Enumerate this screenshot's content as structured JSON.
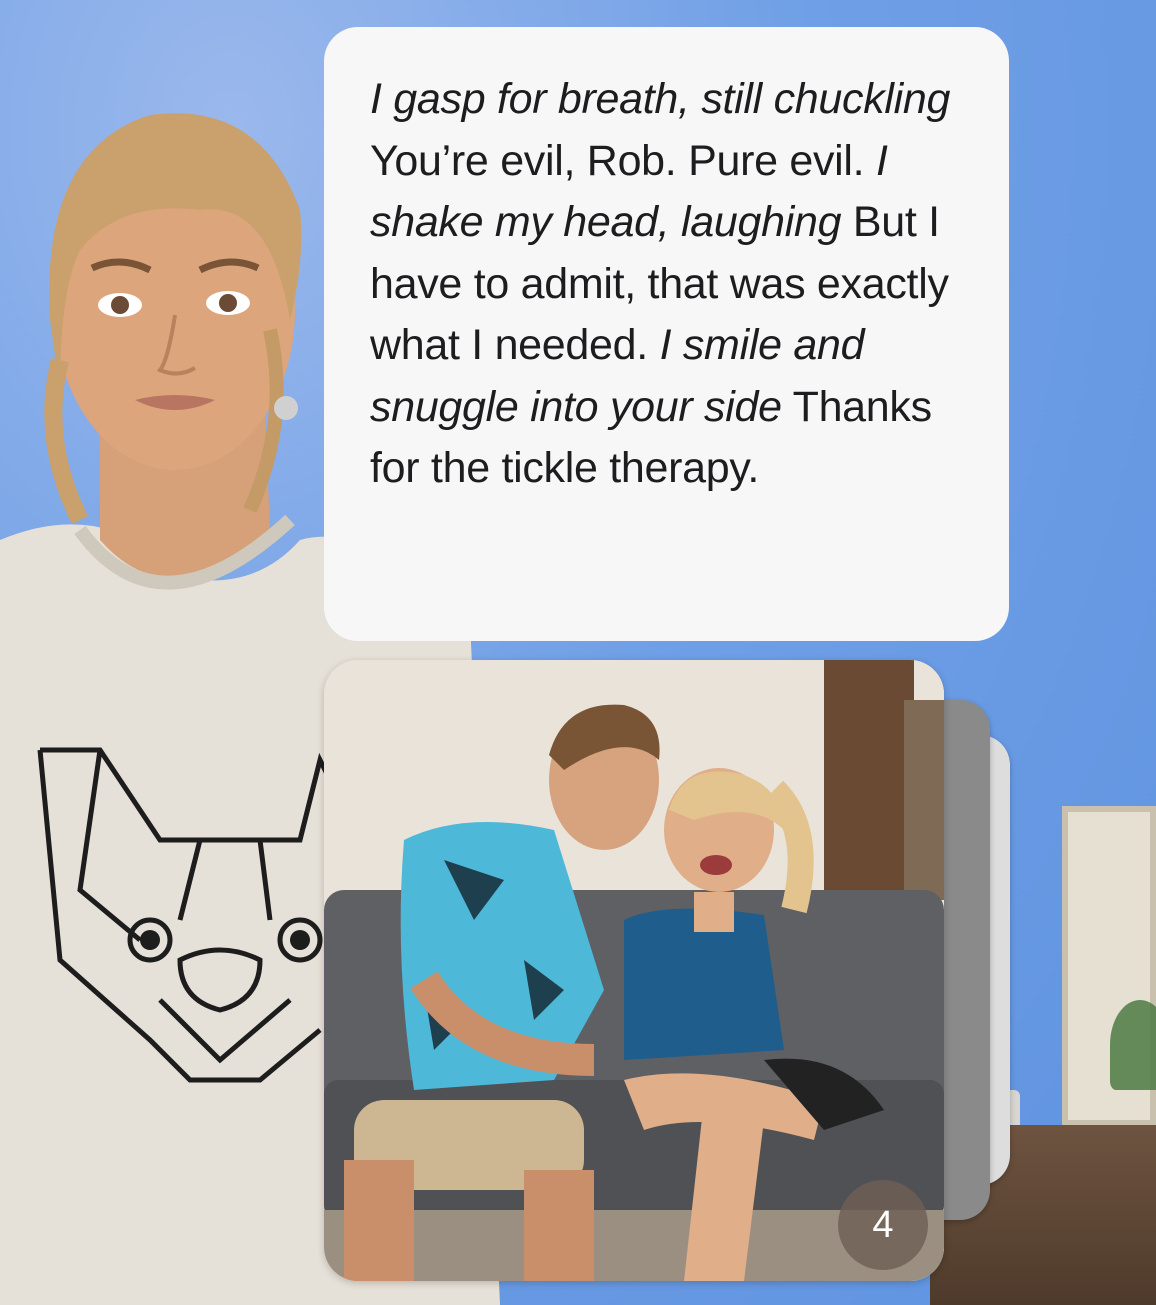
{
  "message": {
    "segments": [
      {
        "text": "I gasp for breath, still chuckling",
        "italic": true
      },
      {
        "text": " You’re evil, Rob. Pure evil. ",
        "italic": false
      },
      {
        "text": "I shake my head, laughing",
        "italic": true
      },
      {
        "text": " But I have to admit, that was exactly what I needed. ",
        "italic": false
      },
      {
        "text": "I smile and snuggle into your side",
        "italic": true
      },
      {
        "text": " Thanks for the tickle therapy.",
        "italic": false
      }
    ]
  },
  "image_stack": {
    "count_label": "4"
  },
  "icons": {
    "avatar": "avatar-character",
    "photo": "generated-photo"
  }
}
